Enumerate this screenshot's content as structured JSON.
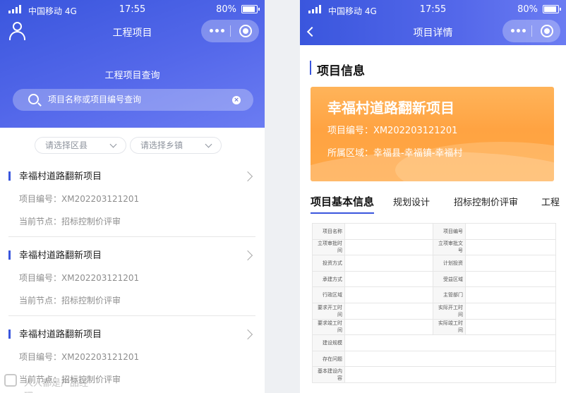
{
  "status_bar": {
    "carrier": "中国移动 4G",
    "time": "17:55",
    "battery": "80%"
  },
  "left": {
    "nav_title": "工程项目",
    "query_title": "工程项目查询",
    "search": {
      "placeholder": "项目名称或项目编号查询"
    },
    "filters": {
      "district": "请选择区县",
      "town": "请选择乡镇"
    },
    "projects": [
      {
        "title": "幸福村道路翻新项目",
        "code": "项目编号：XM202203121201",
        "node": "当前节点：招标控制价评审"
      },
      {
        "title": "幸福村道路翻新项目",
        "code": "项目编号：XM202203121201",
        "node": "当前节点：招标控制价评审"
      },
      {
        "title": "幸福村道路翻新项目",
        "code": "项目编号：XM202203121201",
        "node": "当前节点：招标控制价评审"
      }
    ],
    "watermark": "人人都是产品经理"
  },
  "right": {
    "nav_title": "项目详情",
    "section_title": "项目信息",
    "card": {
      "title": "幸福村道路翻新项目",
      "code": "项目编号：XM202203121201",
      "region": "所属区域：幸福县-幸福镇-幸福村"
    },
    "tabs": [
      "项目基本信息",
      "规划设计",
      "招标控制价评审",
      "工程"
    ],
    "table": {
      "pairs": [
        [
          "项目名称",
          "项目编号"
        ],
        [
          "立项审批时间",
          "立项审批文号"
        ],
        [
          "投资方式",
          "计划投资"
        ],
        [
          "承建方式",
          "受益区域"
        ],
        [
          "行政区域",
          "主管部门"
        ],
        [
          "要求开工时间",
          "实际开工时间"
        ],
        [
          "要求竣工时间",
          "实际竣工时间"
        ]
      ],
      "singles": [
        "建设规模",
        "存在问题",
        "基本建设内容"
      ]
    }
  },
  "colors": {
    "primary": "#3a56dd",
    "card_orange": "#ffa342"
  }
}
